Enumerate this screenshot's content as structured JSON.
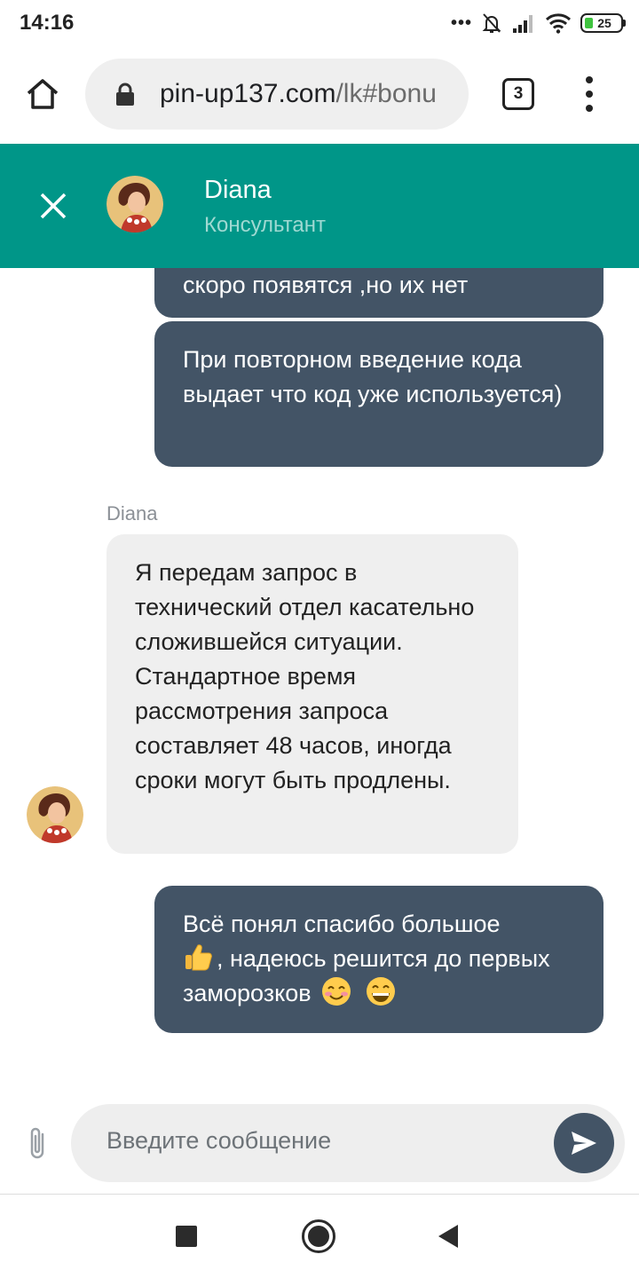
{
  "status_bar": {
    "time": "14:16",
    "dots": "•••",
    "battery": "25"
  },
  "browser": {
    "url_host": "pin-up137.com",
    "url_path": "/lk#bonu",
    "tab_count": "3"
  },
  "chat_header": {
    "agent_name": "Diana",
    "agent_role": "Консультант"
  },
  "messages": [
    {
      "from": "user",
      "text": "скоро появятся ,но их нет"
    },
    {
      "from": "user",
      "text": "При повторном введение кода выдает что код уже используется)"
    },
    {
      "from": "agent",
      "sender": "Diana",
      "text": "Я передам запрос в технический отдел касательно сложившейся ситуации. Стандартное время рассмотрения запроса составляет 48 часов, иногда сроки могут быть продлены."
    },
    {
      "from": "user",
      "text_before": "Всё понял спасибо большое",
      "text_middle": ", надеюсь решится до первых заморозков",
      "emojis": [
        "thumbs-up",
        "smiling-face-blush",
        "grinning-face"
      ]
    }
  ],
  "composer": {
    "placeholder": "Введите сообщение"
  },
  "colors": {
    "header": "#009688",
    "user_bubble": "#435466",
    "agent_bubble": "#efefef",
    "send_button": "#435466"
  }
}
